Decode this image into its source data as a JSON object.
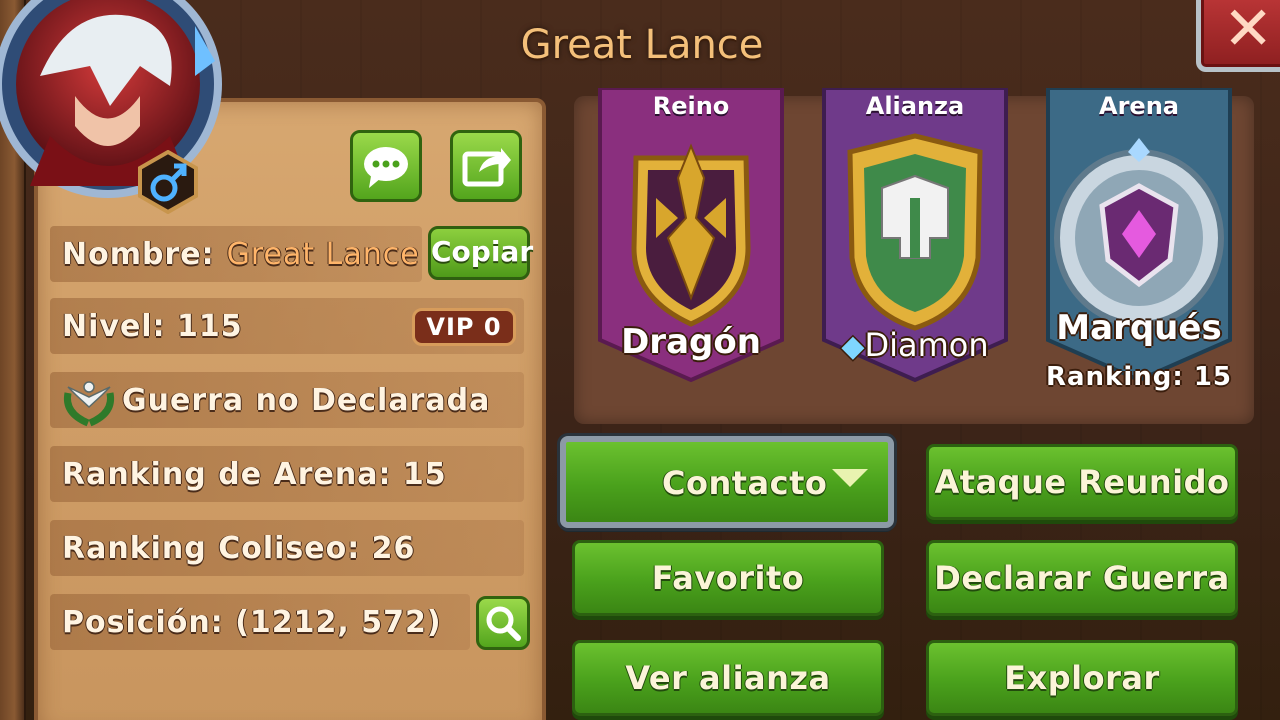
{
  "title": "Great Lance",
  "close_icon": "close-icon",
  "avatar": {
    "gender_symbol": "♂"
  },
  "info": {
    "name_label": "Nombre:",
    "name_value": "Great Lance",
    "copy_label": "Copiar",
    "level_label": "Nivel: 115",
    "vip_label": "VIP 0",
    "war_status": "Guerra no Declarada",
    "arena_ranking": "Ranking de Arena: 15",
    "coliseum_ranking": "Ranking Coliseo: 26",
    "position": "Posición: (1212, 572)"
  },
  "banners": [
    {
      "heading": "Reino",
      "name": "Dragón",
      "color": "#8a2f7e"
    },
    {
      "heading": "Alianza",
      "name": "Diamon",
      "color": "#6f3a8a"
    },
    {
      "heading": "Arena",
      "name": "Marqués",
      "sub": "Ranking: 15",
      "color": "#3c6a86"
    }
  ],
  "buttons": {
    "contact": "Contacto",
    "rally_attack": "Ataque Reunido",
    "favorite": "Favorito",
    "declare_war": "Declarar Guerra",
    "view_alliance": "Ver alianza",
    "explore": "Explorar"
  },
  "colors": {
    "accent_green": "#4aa11c",
    "parchment": "#cf9d66",
    "title_gold": "#f4c07a"
  }
}
